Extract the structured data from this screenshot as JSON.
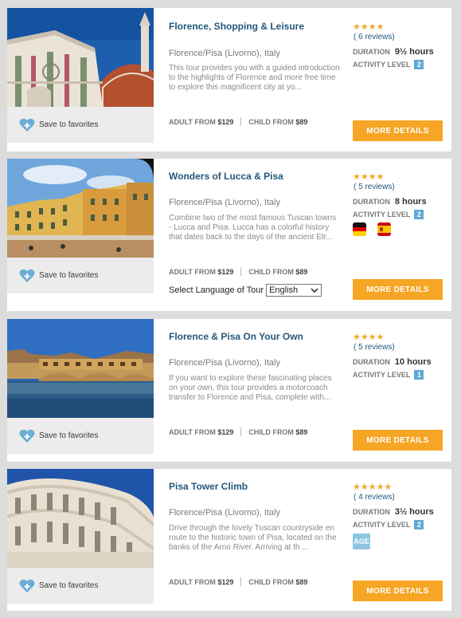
{
  "fav_label": "Save to favorites",
  "more_label": "MORE DETAILS",
  "adult_label": "ADULT FROM",
  "child_label": "CHILD FROM",
  "duration_label": "DURATION",
  "activity_label": "ACTIVITY LEVEL",
  "accent": "#f6a524",
  "title_color": "#24587c",
  "tours": [
    {
      "title": "Florence, Shopping & Leisure",
      "location": "Florence/Pisa (Livorno), Italy",
      "description": "This tour provides you with a guided introduction to the highlights of Florence and more free time to explore this magnificent city at yo...",
      "adult_price": "$129",
      "child_price": "$89",
      "stars": "★★★★",
      "rating": 4,
      "reviews": "( 6 reviews)",
      "duration": "9½ hours",
      "activity_level": "2"
    },
    {
      "title": "Wonders of Lucca & Pisa",
      "location": "Florence/Pisa (Livorno), Italy",
      "description": "Combine two of the most famous Tuscan towns - Lucca and Pisa. Lucca has a colorful history that dates back to the days of the ancient Etr...",
      "adult_price": "$129",
      "child_price": "$89",
      "stars": "★★★★",
      "rating": 4,
      "reviews": "( 5 reviews)",
      "duration": "8 hours",
      "activity_level": "2",
      "language_label": "Select Language of Tour",
      "language_value": "English",
      "flags": [
        "germany-flag-icon",
        "spain-flag-icon"
      ]
    },
    {
      "title": "Florence & Pisa On Your Own",
      "location": "Florence/Pisa (Livorno), Italy",
      "description": "If you want to explore these fascinating places on your own, this tour provides a motorcoach transfer to Florence and Pisa, complete with...",
      "adult_price": "$129",
      "child_price": "$89",
      "stars": "★★★★",
      "rating": 4,
      "reviews": "( 5 reviews)",
      "duration": "10 hours",
      "activity_level": "1"
    },
    {
      "title": "Pisa Tower Climb",
      "location": "Florence/Pisa (Livorno), Italy",
      "description": "Drive through the lovely Tuscan countryside en route to the historic town of Pisa, located on the banks of the Arno River. Arriving at th ...",
      "adult_price": "$129",
      "child_price": "$89",
      "stars": "★★★★★",
      "rating": 5,
      "reviews": "( 4 reviews)",
      "duration": "3½ hours",
      "activity_level": "2",
      "age_badge": "AGE"
    }
  ]
}
